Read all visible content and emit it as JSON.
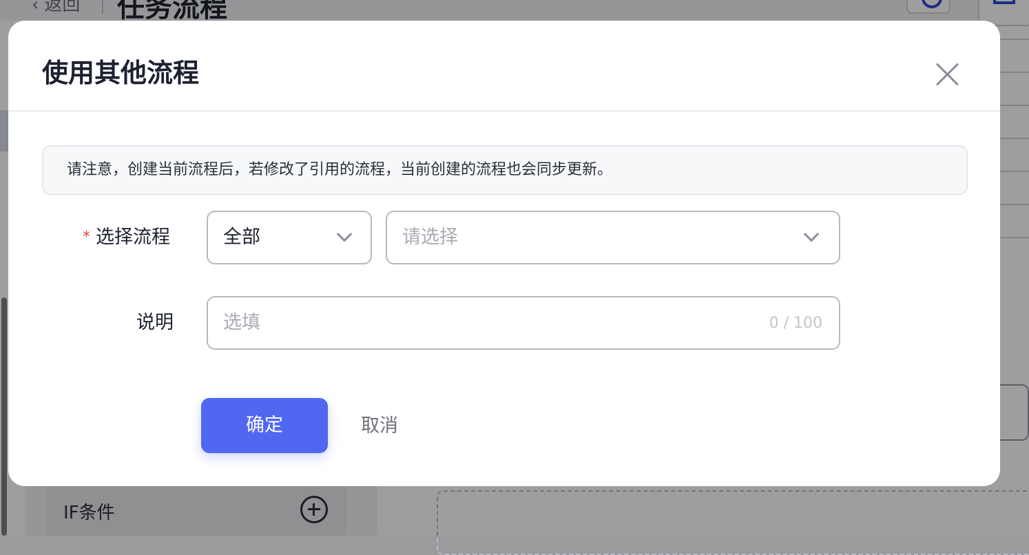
{
  "background": {
    "back_label": "返回",
    "page_title": "任务流程",
    "sidebar_if_label": "IF条件"
  },
  "modal": {
    "title": "使用其他流程",
    "notice": "请注意，创建当前流程后，若修改了引用的流程，当前创建的流程也会同步更新。",
    "flow_field": {
      "required_mark": "*",
      "label": "选择流程",
      "type_select_value": "全部",
      "flow_select_placeholder": "请选择"
    },
    "desc_field": {
      "label": "说明",
      "placeholder": "选填",
      "char_count": "0 / 100"
    },
    "buttons": {
      "confirm": "确定",
      "cancel": "取消"
    }
  },
  "colors": {
    "primary": "#5067f2",
    "required": "#e0443e",
    "overlay": "rgba(0,0,0,0.38)"
  },
  "icons": [
    "chevron-left-icon",
    "history-icon",
    "bell-icon",
    "plus-circle-icon",
    "close-icon",
    "chevron-down-icon"
  ]
}
